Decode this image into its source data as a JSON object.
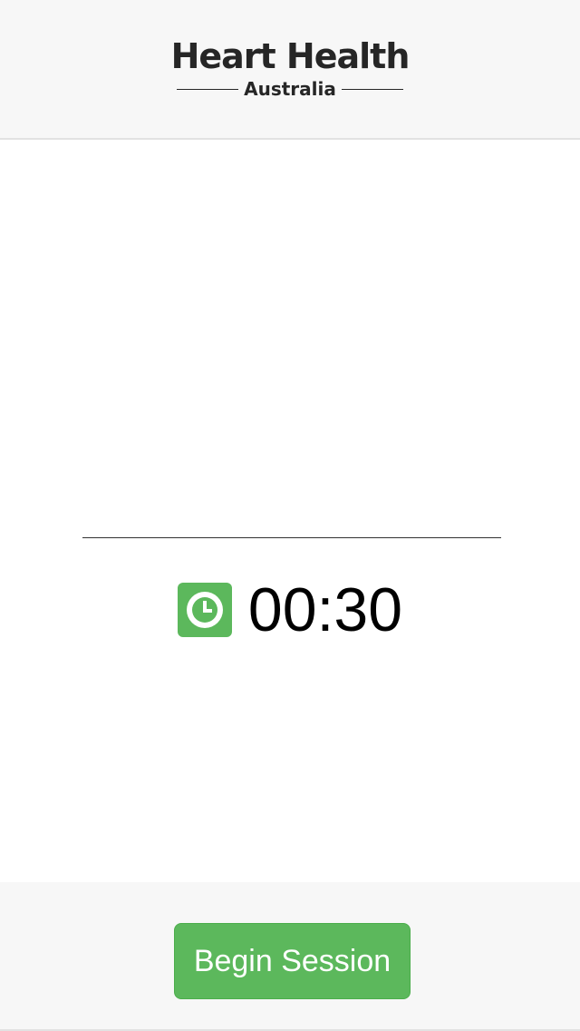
{
  "header": {
    "logo_title": "Heart Health",
    "logo_subtitle": "Australia"
  },
  "timer": {
    "icon": "clock-icon",
    "display": "00:30"
  },
  "footer": {
    "begin_label": "Begin Session"
  },
  "colors": {
    "accent_green": "#5cb85c",
    "bar_background": "#f7f7f7",
    "logo_text": "#262626"
  }
}
